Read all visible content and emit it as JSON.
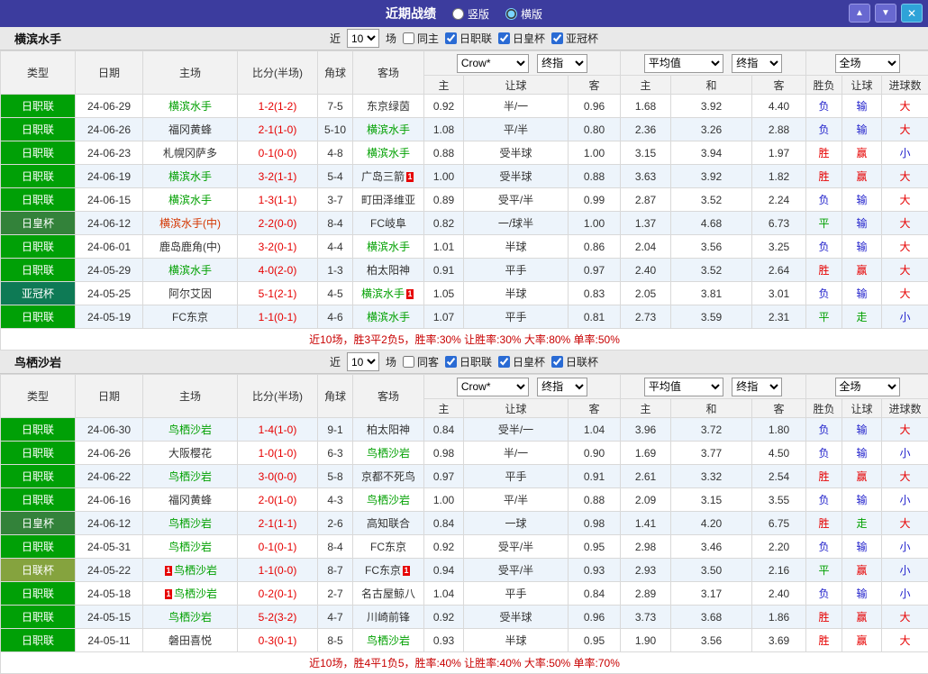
{
  "titlebar": {
    "title": "近期战绩",
    "layout_options": [
      {
        "label": "竖版",
        "selected": false
      },
      {
        "label": "横版",
        "selected": true
      }
    ],
    "buttons": {
      "up": "▲",
      "down": "▼",
      "close": "✕"
    }
  },
  "filter_labels": {
    "near": "近",
    "games": "场"
  },
  "table_header": {
    "type": "类型",
    "date": "日期",
    "home": "主场",
    "score": "比分(半场)",
    "corner": "角球",
    "away": "客场",
    "odds_company": "Crow*",
    "odds_final": "终指",
    "avg": "平均值",
    "avg_final": "终指",
    "full": "全场",
    "sub": [
      "主",
      "让球",
      "客",
      "主",
      "和",
      "客",
      "胜负",
      "让球",
      "进球数"
    ]
  },
  "colors": {
    "accent_bar": "#3c3c9e",
    "league_jl": "#00a006",
    "league_emperor": "#33823a",
    "league_acl": "#0e7a55",
    "league_lcup": "#85a33e",
    "self_team": "#00a000",
    "score_red": "#e60000",
    "loss_blue": "#2323cc",
    "draw_green": "#00a000",
    "summary_red": "#c80000"
  },
  "sections": [
    {
      "team": "横滨水手",
      "filter": {
        "count": "10",
        "same": {
          "label": "同主",
          "checked": false
        },
        "leagues": [
          {
            "label": "日职联",
            "checked": true
          },
          {
            "label": "日皇杯",
            "checked": true
          },
          {
            "label": "亚冠杯",
            "checked": true
          }
        ]
      },
      "rows": [
        {
          "league": "日职联",
          "date": "24-06-29",
          "home": {
            "name": "横滨水手",
            "self": true
          },
          "score": "1-2(1-2)",
          "corner": "7-5",
          "away": {
            "name": "东京绿茵"
          },
          "odds": [
            "0.92",
            "半/一",
            "0.96"
          ],
          "avg": [
            "1.68",
            "3.92",
            "4.40"
          ],
          "result": "负",
          "handicap": "输",
          "goals": "大"
        },
        {
          "league": "日职联",
          "date": "24-06-26",
          "home": {
            "name": "福冈黄蜂"
          },
          "score": "2-1(1-0)",
          "corner": "5-10",
          "away": {
            "name": "横滨水手",
            "self": true
          },
          "odds": [
            "1.08",
            "平/半",
            "0.80"
          ],
          "avg": [
            "2.36",
            "3.26",
            "2.88"
          ],
          "result": "负",
          "handicap": "输",
          "goals": "大"
        },
        {
          "league": "日职联",
          "date": "24-06-23",
          "home": {
            "name": "札幌冈萨多"
          },
          "score": "0-1(0-0)",
          "corner": "4-8",
          "away": {
            "name": "横滨水手",
            "self": true
          },
          "odds": [
            "0.88",
            "受半球",
            "1.00"
          ],
          "avg": [
            "3.15",
            "3.94",
            "1.97"
          ],
          "result": "胜",
          "handicap": "赢",
          "goals": "小"
        },
        {
          "league": "日职联",
          "date": "24-06-19",
          "home": {
            "name": "横滨水手",
            "self": true
          },
          "score": "3-2(1-1)",
          "corner": "5-4",
          "away": {
            "name": "广岛三箭",
            "badge": "1"
          },
          "odds": [
            "1.00",
            "受半球",
            "0.88"
          ],
          "avg": [
            "3.63",
            "3.92",
            "1.82"
          ],
          "result": "胜",
          "handicap": "赢",
          "goals": "大"
        },
        {
          "league": "日职联",
          "date": "24-06-15",
          "home": {
            "name": "横滨水手",
            "self": true
          },
          "score": "1-3(1-1)",
          "corner": "3-7",
          "away": {
            "name": "町田泽维亚"
          },
          "odds": [
            "0.89",
            "受平/半",
            "0.99"
          ],
          "avg": [
            "2.87",
            "3.52",
            "2.24"
          ],
          "result": "负",
          "handicap": "输",
          "goals": "大"
        },
        {
          "league": "日皇杯",
          "date": "24-06-12",
          "home": {
            "name": "横滨水手(中)",
            "self": true,
            "red": true
          },
          "score": "2-2(0-0)",
          "corner": "8-4",
          "away": {
            "name": "FC岐阜"
          },
          "odds": [
            "0.82",
            "一/球半",
            "1.00"
          ],
          "avg": [
            "1.37",
            "4.68",
            "6.73"
          ],
          "result": "平",
          "handicap": "输",
          "goals": "大"
        },
        {
          "league": "日职联",
          "date": "24-06-01",
          "home": {
            "name": "鹿岛鹿角(中)"
          },
          "score": "3-2(0-1)",
          "corner": "4-4",
          "away": {
            "name": "横滨水手",
            "self": true
          },
          "odds": [
            "1.01",
            "半球",
            "0.86"
          ],
          "avg": [
            "2.04",
            "3.56",
            "3.25"
          ],
          "result": "负",
          "handicap": "输",
          "goals": "大"
        },
        {
          "league": "日职联",
          "date": "24-05-29",
          "home": {
            "name": "横滨水手",
            "self": true
          },
          "score": "4-0(2-0)",
          "corner": "1-3",
          "away": {
            "name": "柏太阳神"
          },
          "odds": [
            "0.91",
            "平手",
            "0.97"
          ],
          "avg": [
            "2.40",
            "3.52",
            "2.64"
          ],
          "result": "胜",
          "handicap": "赢",
          "goals": "大"
        },
        {
          "league": "亚冠杯",
          "date": "24-05-25",
          "home": {
            "name": "阿尔艾因"
          },
          "score": "5-1(2-1)",
          "corner": "4-5",
          "away": {
            "name": "横滨水手",
            "self": true,
            "badge": "1"
          },
          "odds": [
            "1.05",
            "半球",
            "0.83"
          ],
          "avg": [
            "2.05",
            "3.81",
            "3.01"
          ],
          "result": "负",
          "handicap": "输",
          "goals": "大"
        },
        {
          "league": "日职联",
          "date": "24-05-19",
          "home": {
            "name": "FC东京"
          },
          "score": "1-1(0-1)",
          "corner": "4-6",
          "away": {
            "name": "横滨水手",
            "self": true
          },
          "odds": [
            "1.07",
            "平手",
            "0.81"
          ],
          "avg": [
            "2.73",
            "3.59",
            "2.31"
          ],
          "result": "平",
          "handicap": "走",
          "goals": "小"
        }
      ],
      "summary": "近10场，胜3平2负5，胜率:30% 让胜率:30% 大率:80% 单率:50%"
    },
    {
      "team": "鸟栖沙岩",
      "filter": {
        "count": "10",
        "same": {
          "label": "同客",
          "checked": false
        },
        "leagues": [
          {
            "label": "日职联",
            "checked": true
          },
          {
            "label": "日皇杯",
            "checked": true
          },
          {
            "label": "日联杯",
            "checked": true
          }
        ]
      },
      "rows": [
        {
          "league": "日职联",
          "date": "24-06-30",
          "home": {
            "name": "鸟栖沙岩",
            "self": true
          },
          "score": "1-4(1-0)",
          "corner": "9-1",
          "away": {
            "name": "柏太阳神"
          },
          "odds": [
            "0.84",
            "受半/一",
            "1.04"
          ],
          "avg": [
            "3.96",
            "3.72",
            "1.80"
          ],
          "result": "负",
          "handicap": "输",
          "goals": "大"
        },
        {
          "league": "日职联",
          "date": "24-06-26",
          "home": {
            "name": "大阪樱花"
          },
          "score": "1-0(1-0)",
          "corner": "6-3",
          "away": {
            "name": "鸟栖沙岩",
            "self": true
          },
          "odds": [
            "0.98",
            "半/一",
            "0.90"
          ],
          "avg": [
            "1.69",
            "3.77",
            "4.50"
          ],
          "result": "负",
          "handicap": "输",
          "goals": "小"
        },
        {
          "league": "日职联",
          "date": "24-06-22",
          "home": {
            "name": "鸟栖沙岩",
            "self": true
          },
          "score": "3-0(0-0)",
          "corner": "5-8",
          "away": {
            "name": "京都不死鸟"
          },
          "odds": [
            "0.97",
            "平手",
            "0.91"
          ],
          "avg": [
            "2.61",
            "3.32",
            "2.54"
          ],
          "result": "胜",
          "handicap": "赢",
          "goals": "大"
        },
        {
          "league": "日职联",
          "date": "24-06-16",
          "home": {
            "name": "福冈黄蜂"
          },
          "score": "2-0(1-0)",
          "corner": "4-3",
          "away": {
            "name": "鸟栖沙岩",
            "self": true
          },
          "odds": [
            "1.00",
            "平/半",
            "0.88"
          ],
          "avg": [
            "2.09",
            "3.15",
            "3.55"
          ],
          "result": "负",
          "handicap": "输",
          "goals": "小"
        },
        {
          "league": "日皇杯",
          "date": "24-06-12",
          "home": {
            "name": "鸟栖沙岩",
            "self": true
          },
          "score": "2-1(1-1)",
          "corner": "2-6",
          "away": {
            "name": "高知联合"
          },
          "odds": [
            "0.84",
            "一球",
            "0.98"
          ],
          "avg": [
            "1.41",
            "4.20",
            "6.75"
          ],
          "result": "胜",
          "handicap": "走",
          "goals": "大"
        },
        {
          "league": "日职联",
          "date": "24-05-31",
          "home": {
            "name": "鸟栖沙岩",
            "self": true
          },
          "score": "0-1(0-1)",
          "corner": "8-4",
          "away": {
            "name": "FC东京"
          },
          "odds": [
            "0.92",
            "受平/半",
            "0.95"
          ],
          "avg": [
            "2.98",
            "3.46",
            "2.20"
          ],
          "result": "负",
          "handicap": "输",
          "goals": "小"
        },
        {
          "league": "日联杯",
          "date": "24-05-22",
          "home": {
            "name": "鸟栖沙岩",
            "self": true,
            "badge": "1"
          },
          "score": "1-1(0-0)",
          "corner": "8-7",
          "away": {
            "name": "FC东京",
            "badge": "1"
          },
          "odds": [
            "0.94",
            "受平/半",
            "0.93"
          ],
          "avg": [
            "2.93",
            "3.50",
            "2.16"
          ],
          "result": "平",
          "handicap": "赢",
          "goals": "小"
        },
        {
          "league": "日职联",
          "date": "24-05-18",
          "home": {
            "name": "鸟栖沙岩",
            "self": true,
            "badge": "1"
          },
          "score": "0-2(0-1)",
          "corner": "2-7",
          "away": {
            "name": "名古屋鲸八"
          },
          "odds": [
            "1.04",
            "平手",
            "0.84"
          ],
          "avg": [
            "2.89",
            "3.17",
            "2.40"
          ],
          "result": "负",
          "handicap": "输",
          "goals": "小"
        },
        {
          "league": "日职联",
          "date": "24-05-15",
          "home": {
            "name": "鸟栖沙岩",
            "self": true
          },
          "score": "5-2(3-2)",
          "corner": "4-7",
          "away": {
            "name": "川崎前锋"
          },
          "odds": [
            "0.92",
            "受半球",
            "0.96"
          ],
          "avg": [
            "3.73",
            "3.68",
            "1.86"
          ],
          "result": "胜",
          "handicap": "赢",
          "goals": "大"
        },
        {
          "league": "日职联",
          "date": "24-05-11",
          "home": {
            "name": "磐田喜悦"
          },
          "score": "0-3(0-1)",
          "corner": "8-5",
          "away": {
            "name": "鸟栖沙岩",
            "self": true
          },
          "odds": [
            "0.93",
            "半球",
            "0.95"
          ],
          "avg": [
            "1.90",
            "3.56",
            "3.69"
          ],
          "result": "胜",
          "handicap": "赢",
          "goals": "大"
        }
      ],
      "summary": "近10场，胜4平1负5，胜率:40% 让胜率:40% 大率:50% 单率:70%"
    }
  ]
}
